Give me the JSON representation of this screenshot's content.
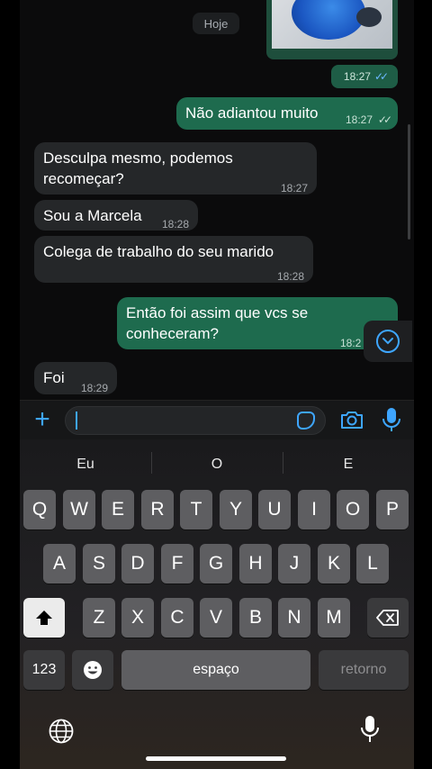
{
  "chat": {
    "date_label": "Hoje",
    "image_message": {
      "time": "18:27",
      "read": true
    },
    "messages": [
      {
        "dir": "out",
        "text": "Não adiantou muito",
        "time": "18:27",
        "read": true
      },
      {
        "dir": "in",
        "text": "Desculpa mesmo, podemos recomeçar?",
        "time": "18:27"
      },
      {
        "dir": "in",
        "text": "Sou a Marcela",
        "time": "18:28"
      },
      {
        "dir": "in",
        "text": "Colega de trabalho do seu marido",
        "time": "18:28"
      },
      {
        "dir": "out",
        "text": "Então foi assim que vcs se conheceram?",
        "time": "18:2"
      },
      {
        "dir": "in",
        "text": "Foi",
        "time": "18:29"
      }
    ]
  },
  "composer": {
    "value": "",
    "placeholder": ""
  },
  "keyboard": {
    "suggestions": [
      "Eu",
      "O",
      "E"
    ],
    "row1": [
      "Q",
      "W",
      "E",
      "R",
      "T",
      "Y",
      "U",
      "I",
      "O",
      "P"
    ],
    "row2": [
      "A",
      "S",
      "D",
      "F",
      "G",
      "H",
      "J",
      "K",
      "L"
    ],
    "row3": [
      "Z",
      "X",
      "C",
      "V",
      "B",
      "N",
      "M"
    ],
    "numbers_label": "123",
    "space_label": "espaço",
    "return_label": "retorno"
  },
  "colors": {
    "accent": "#3ea6ff",
    "outgoing_bubble": "#1e6b4e",
    "incoming_bubble": "#252729",
    "read_ticks": "#6cb8ff"
  }
}
